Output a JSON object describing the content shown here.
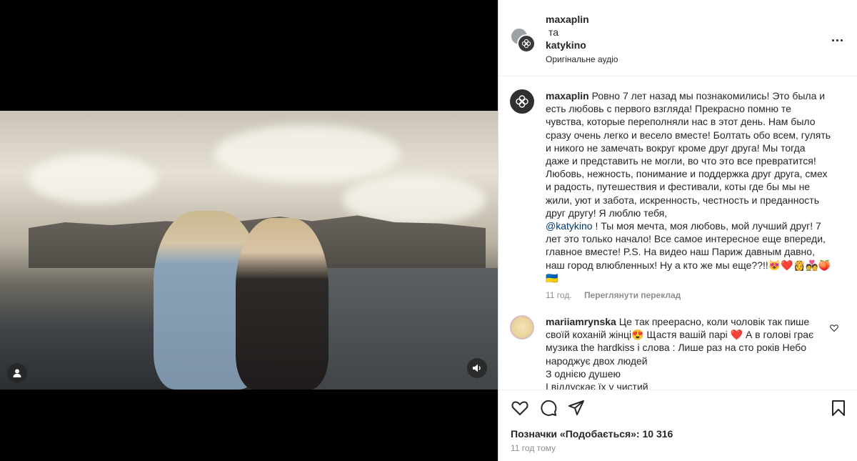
{
  "post": {
    "author": "maxaplin",
    "connector": "та",
    "coauthor": "katykino",
    "audio": "Оригінальне аудіо"
  },
  "caption": {
    "user": "maxaplin",
    "text_before_mention": "Ровно 7 лет назад мы познакомились! Это была и есть любовь с первого взгляда! Прекрасно помню те чувства, которые переполняли нас в этот день. Нам было сразу очень легко и весело вместе! Болтать обо всем, гулять и никого не замечать вокруг кроме друг друга! Мы тогда даже и представить не могли, во что это все превратится! Любовь, нежность, понимание и поддержка друг друга, смех и радость, путешествия и фестивали, коты где бы мы не жили, уют и забота, искренность, честность и преданность друг другу! Я люблю тебя,",
    "mention": "@katykino",
    "text_after_mention": " ! Ты моя мечта, моя любовь, мой лучший друг! 7 лет это только начало! Все самое интересное еще впереди, главное вместе! P.S. На видео наш Париж давным давно, наш город влюбленных! Ну а кто же мы еще??!!😻❤️👸💑🍑🇺🇦",
    "age": "11 год.",
    "translate": "Переглянути переклад"
  },
  "comment": {
    "user": "mariiamrynska",
    "text": "Це так преерасно, коли чоловік так пише своїй коханій жінці😍 Щастя вашій парі ❤️ А в голові грає музика the hardkiss і слова : Лише раз на сто років Небо народжує двох людей",
    "line2": "З однією душею",
    "line3": "І віддускає їх у чистий"
  },
  "footer": {
    "likes": "Позначки «Подобається»: 10 316",
    "time": "11 год тому"
  },
  "icons": {
    "like": "heart-icon",
    "comment": "comment-icon",
    "share": "share-icon",
    "save": "bookmark-icon",
    "more": "more-icon",
    "mute": "speaker-icon",
    "tagged": "user-icon"
  }
}
